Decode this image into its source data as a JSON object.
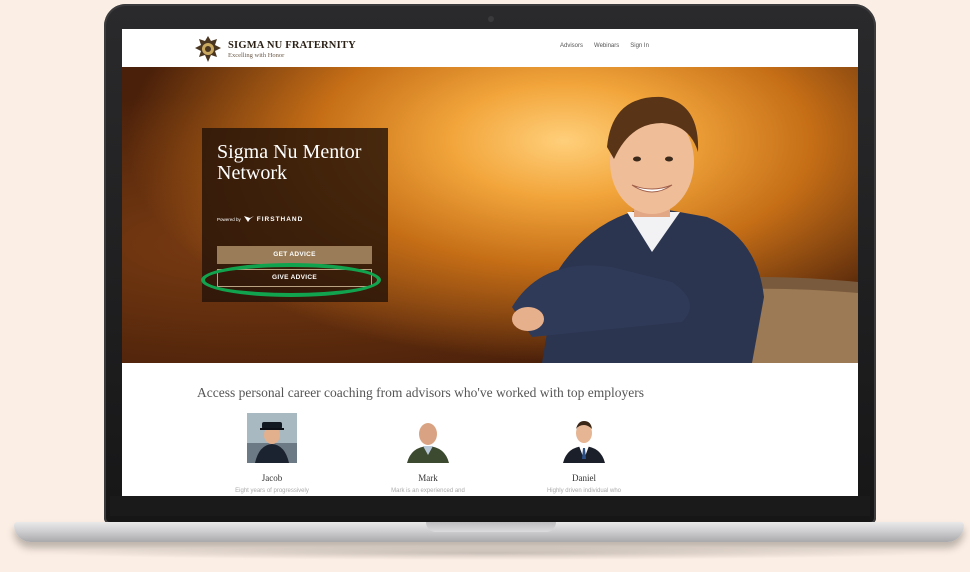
{
  "site": {
    "brand_name": "SIGMA NU FRATERNITY",
    "brand_tagline": "Excelling with Honor",
    "nav": [
      "Advisors",
      "Webinars",
      "Sign In"
    ]
  },
  "hero": {
    "title": "Sigma Nu Mentor Network",
    "powered_by": "Powered by",
    "partner": "FIRSTHAND",
    "get_advice": "GET ADVICE",
    "give_advice": "GIVE ADVICE"
  },
  "section": {
    "tagline": "Access personal career coaching from advisors who've worked with top employers"
  },
  "advisors": [
    {
      "name": "Jacob",
      "blurb": "Eight years of progressively"
    },
    {
      "name": "Mark",
      "blurb": "Mark is an experienced and"
    },
    {
      "name": "Daniel",
      "blurb": "Highly driven individual who"
    }
  ],
  "colors": {
    "highlight_ring": "#12a34f",
    "get_advice_button": "#9a7d58",
    "page_background": "#fbeee4"
  },
  "icons": [
    "sigma-nu-crest-icon",
    "firsthand-logo-icon"
  ]
}
